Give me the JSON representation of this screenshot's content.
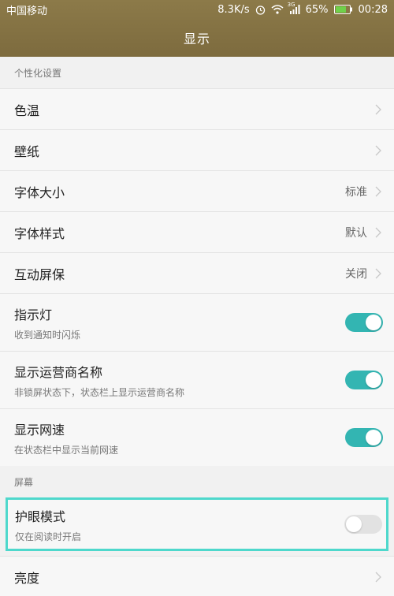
{
  "status_bar": {
    "carrier": "中国移动",
    "net_speed": "8.3K/s",
    "network_type": "3G",
    "battery": "65%",
    "time": "00:28"
  },
  "header": {
    "title": "显示"
  },
  "sections": {
    "personal": {
      "label": "个性化设置",
      "items": [
        {
          "title": "色温"
        },
        {
          "title": "壁纸"
        },
        {
          "title": "字体大小",
          "value": "标准"
        },
        {
          "title": "字体样式",
          "value": "默认"
        },
        {
          "title": "互动屏保",
          "value": "关闭"
        },
        {
          "title": "指示灯",
          "subtitle": "收到通知时闪烁",
          "enabled": true
        },
        {
          "title": "显示运营商名称",
          "subtitle": "非锁屏状态下，状态栏上显示运营商名称",
          "enabled": true
        },
        {
          "title": "显示网速",
          "subtitle": "在状态栏中显示当前网速",
          "enabled": true
        }
      ]
    },
    "screen": {
      "label": "屏幕",
      "items": [
        {
          "title": "护眼模式",
          "subtitle": "仅在阅读时开启",
          "enabled": false
        },
        {
          "title": "亮度"
        }
      ]
    }
  },
  "colors": {
    "header_bg": "#8c7a49",
    "toggle_on": "#33b5b2",
    "toggle_off": "#e2e2e2",
    "highlight_border": "#4ed8cc"
  }
}
